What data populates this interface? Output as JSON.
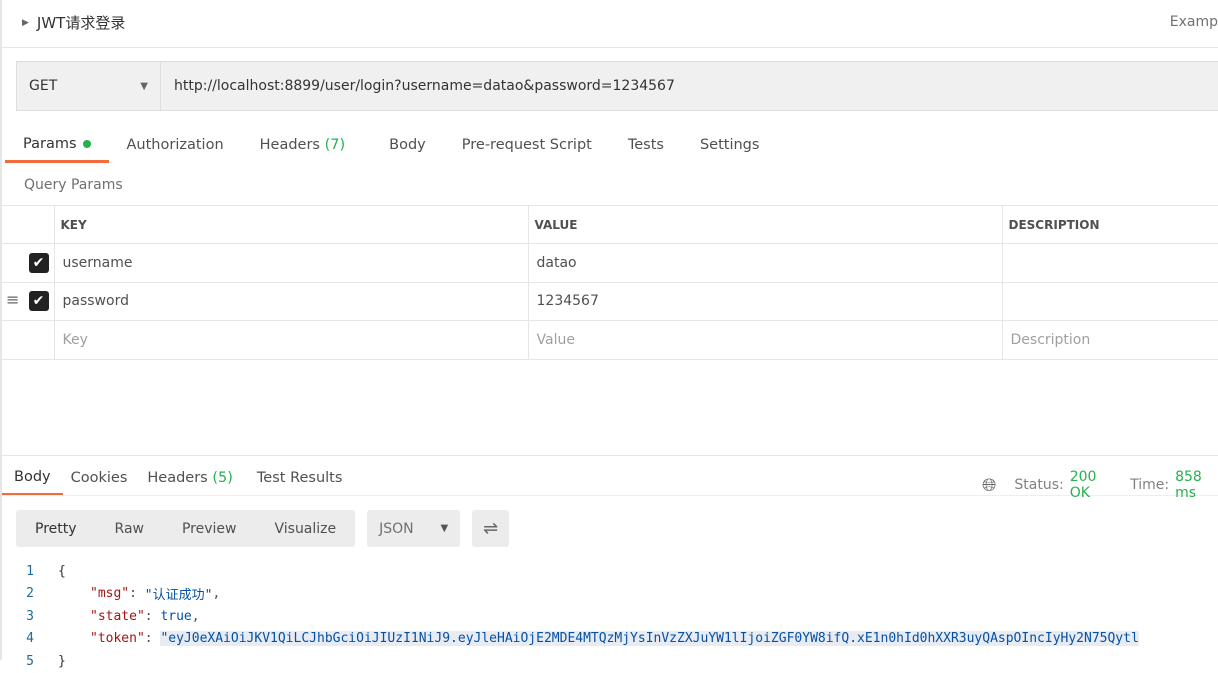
{
  "request": {
    "title": "JWT请求登录",
    "examples_label": "Examp",
    "method": "GET",
    "url": "http://localhost:8899/user/login?username=datao&password=1234567"
  },
  "req_tabs": [
    {
      "label": "Params"
    },
    {
      "label": "Authorization"
    },
    {
      "label": "Headers",
      "count": "(7)"
    },
    {
      "label": "Body"
    },
    {
      "label": "Pre-request Script"
    },
    {
      "label": "Tests"
    },
    {
      "label": "Settings"
    }
  ],
  "query_params": {
    "title": "Query Params",
    "headers": [
      "KEY",
      "VALUE",
      "DESCRIPTION"
    ],
    "rows": [
      {
        "key": "username",
        "value": "datao",
        "checked": true
      },
      {
        "key": "password",
        "value": "1234567",
        "checked": true
      }
    ],
    "placeholders": {
      "key": "Key",
      "value": "Value",
      "description": "Description"
    }
  },
  "resp_tabs": [
    {
      "label": "Body"
    },
    {
      "label": "Cookies"
    },
    {
      "label": "Headers",
      "count": "(5)"
    },
    {
      "label": "Test Results"
    }
  ],
  "status": {
    "status_label": "Status:",
    "status_value": "200 OK",
    "time_label": "Time:",
    "time_value": "858 ms",
    "color": "#26b050"
  },
  "view": {
    "modes": [
      "Pretty",
      "Raw",
      "Preview",
      "Visualize"
    ],
    "format": "JSON"
  },
  "code": {
    "lines": [
      "1",
      "2",
      "3",
      "4",
      "5"
    ],
    "open": "{",
    "close": "}",
    "msg_key": "\"msg\"",
    "msg_val": "\"认证成功\"",
    "state_key": "\"state\"",
    "state_val": "true",
    "token_key": "\"token\"",
    "token_val": "\"eyJ0eXAiOiJKV1QiLCJhbGciOiJIUzI1NiJ9.eyJleHAiOjE2MDE4MTQzMjYsInVzZXJuYW1lIjoiZGF0YW8ifQ.xE1n0hId0hXXR3uyQAspOIncIyHy2N75Qytl"
  }
}
